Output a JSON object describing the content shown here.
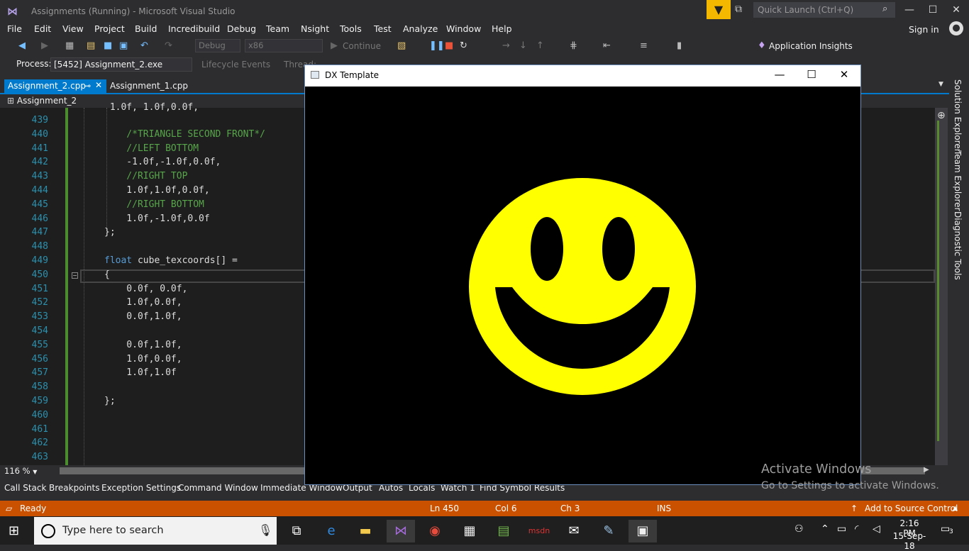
{
  "window": {
    "title": "Assignments (Running) - Microsoft Visual Studio",
    "quick_launch_placeholder": "Quick Launch (Ctrl+Q)",
    "minimize": "—",
    "maximize": "☐",
    "close": "✕"
  },
  "menu": {
    "items": [
      "File",
      "Edit",
      "View",
      "Project",
      "Build",
      "Incredibuild",
      "Debug",
      "Team",
      "Nsight",
      "Tools",
      "Test",
      "Analyze",
      "Window",
      "Help"
    ],
    "sign_in": "Sign in"
  },
  "toolbar": {
    "config": "Debug",
    "platform": "x86",
    "continue": "Continue",
    "app_insights": "Application Insights"
  },
  "debug_location": {
    "process_label": "Process:",
    "process_value": "[5452] Assignment_2.exe",
    "lifecycle": "Lifecycle Events",
    "thread": "Thread:"
  },
  "tabs": {
    "active": "Assignment_2.cpp",
    "inactive": "Assignment_1.cpp",
    "scope": "Assignment_2"
  },
  "editor": {
    "lines": [
      {
        "n": "439",
        "t": "",
        "c": "code"
      },
      {
        "n": "440",
        "t": "    /*TRIANGLE SECOND FRONT*/",
        "c": "cmt"
      },
      {
        "n": "441",
        "t": "    //LEFT BOTTOM",
        "c": "cmt"
      },
      {
        "n": "442",
        "t": "    -1.0f,-1.0f,0.0f,",
        "c": "code"
      },
      {
        "n": "443",
        "t": "    //RIGHT TOP",
        "c": "cmt"
      },
      {
        "n": "444",
        "t": "    1.0f,1.0f,0.0f,",
        "c": "code"
      },
      {
        "n": "445",
        "t": "    //RIGHT BOTTOM",
        "c": "cmt"
      },
      {
        "n": "446",
        "t": "    1.0f,-1.0f,0.0f",
        "c": "code"
      },
      {
        "n": "447",
        "t": "};",
        "c": "code"
      },
      {
        "n": "448",
        "t": "",
        "c": "code"
      },
      {
        "n": "449",
        "t": "float cube_texcoords[] =",
        "c": "kwline"
      },
      {
        "n": "450",
        "t": "{",
        "c": "code"
      },
      {
        "n": "451",
        "t": "    0.0f, 0.0f,",
        "c": "code"
      },
      {
        "n": "452",
        "t": "    1.0f,0.0f,",
        "c": "code"
      },
      {
        "n": "453",
        "t": "    0.0f,1.0f,",
        "c": "code"
      },
      {
        "n": "454",
        "t": "",
        "c": "code"
      },
      {
        "n": "455",
        "t": "    0.0f,1.0f,",
        "c": "code"
      },
      {
        "n": "456",
        "t": "    1.0f,0.0f,",
        "c": "code"
      },
      {
        "n": "457",
        "t": "    1.0f,1.0f",
        "c": "code"
      },
      {
        "n": "458",
        "t": "",
        "c": "code"
      },
      {
        "n": "459",
        "t": "};",
        "c": "code"
      },
      {
        "n": "460",
        "t": "",
        "c": "code"
      },
      {
        "n": "461",
        "t": "",
        "c": "code"
      },
      {
        "n": "462",
        "t": "",
        "c": "code"
      },
      {
        "n": "463",
        "t": "",
        "c": "code"
      }
    ],
    "top_partial": " 1.0f, 1.0f,0.0f,",
    "zoom": "116 %"
  },
  "bottom_tabs": [
    "Call Stack",
    "Breakpoints",
    "Exception Settings",
    "Command Window",
    "Immediate Window",
    "Output",
    "Autos",
    "Locals",
    "Watch 1",
    "Find Symbol Results"
  ],
  "status": {
    "ready": "Ready",
    "ln": "Ln 450",
    "col": "Col 6",
    "ch": "Ch 3",
    "ins": "INS",
    "source_control": "Add to Source Control"
  },
  "right_tabs": [
    "Solution Explorer",
    "Team Explorer",
    "Diagnostic Tools"
  ],
  "dx_window": {
    "title": "DX Template",
    "face_color": "#ffff00"
  },
  "activate": {
    "line1": "Activate Windows",
    "line2": "Go to Settings to activate Windows."
  },
  "taskbar": {
    "search_placeholder": "Type here to search",
    "time": "2:16 PM",
    "date": "15-Sep-18",
    "notifications": "3"
  }
}
